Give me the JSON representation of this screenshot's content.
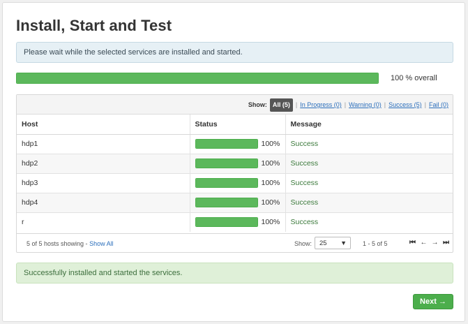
{
  "page": {
    "title": "Install, Start and Test",
    "info_message": "Please wait while the selected services are installed and started.",
    "overall_progress": 100,
    "overall_label": "100 % overall",
    "success_message": "Successfully installed and started the services.",
    "next_label": "Next →"
  },
  "filter": {
    "show_label": "Show:",
    "all": "All (5)",
    "in_progress": "In Progress (0)",
    "warning": "Warning (0)",
    "success": "Success (5)",
    "fail": "Fail (0)"
  },
  "table": {
    "headers": {
      "host": "Host",
      "status": "Status",
      "message": "Message"
    },
    "rows": [
      {
        "host": "hdp1",
        "progress": 100,
        "pct": "100%",
        "message": "Success"
      },
      {
        "host": "hdp2",
        "progress": 100,
        "pct": "100%",
        "message": "Success"
      },
      {
        "host": "hdp3",
        "progress": 100,
        "pct": "100%",
        "message": "Success"
      },
      {
        "host": "hdp4",
        "progress": 100,
        "pct": "100%",
        "message": "Success"
      },
      {
        "host": "r",
        "progress": 100,
        "pct": "100%",
        "message": "Success"
      }
    ]
  },
  "footer": {
    "showing": "5 of 5 hosts showing - ",
    "show_all": "Show All",
    "show_label": "Show:",
    "page_size": "25",
    "range": "1 - 5 of 5"
  },
  "icons": {
    "first": "first-page-icon",
    "prev": "prev-page-icon",
    "next": "next-page-icon",
    "last": "last-page-icon"
  },
  "colors": {
    "progress": "#5cb85c",
    "success_text": "#3c7a3c",
    "link": "#2a6ebb",
    "button": "#4cae4c"
  }
}
